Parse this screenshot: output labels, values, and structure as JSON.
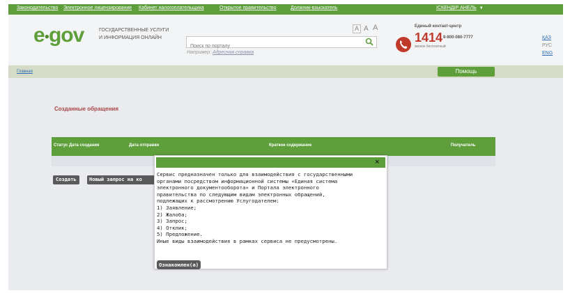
{
  "topnav": {
    "links": [
      "Законодательство",
      "Электронное лицензирование",
      "Кабинет налогоплательщика",
      "Открытое правительство",
      "Должник-взыскатель"
    ],
    "user": "ІСКЕНДІР АНЕЛЬ"
  },
  "header": {
    "logo": "e",
    "logo_tail": "gov",
    "tagline_line1": "ГОСУДАРСТВЕННЫЕ УСЛУГИ",
    "tagline_line2": "И ИНФОРМАЦИЯ ОНЛАЙН",
    "search_placeholder": "Поиск по порталу",
    "example_prefix": "Например:",
    "example_link": "Адресная справка",
    "font_sizes": [
      "A",
      "A",
      "A"
    ],
    "contact_label": "Единый контакт-центр",
    "contact_number": "1414",
    "contact_alt": "8-800-080-7777",
    "contact_free": "звонок бесплатный",
    "languages": [
      "ҚАЗ",
      "РУС",
      "ENG"
    ]
  },
  "breadcrumb": "Главная",
  "help_label": "Помощь",
  "page_title": "Созданные обращения",
  "table": {
    "columns": [
      "Статус",
      "Дата создания",
      "Дата отправки",
      "Краткое содержание",
      "Получатель"
    ]
  },
  "buttons": {
    "create": "Создать",
    "new_request": "Новый запрос на ко"
  },
  "modal": {
    "close": "×",
    "lines": [
      "Сервис предназначен только для взаимодействия с государственными",
      "органами посредством информационной системы «Единая система",
      "электронного документооборота» и Портала электронного",
      "правительства по следующим видам электронных обращений,",
      "подлежащих к рассмотрению Услугодателем:",
      "1) Заявление;",
      "2) Жалоба;",
      "3) Запрос;",
      "4) Отклик;",
      "5) Предложение.",
      "Иные виды взаимодействия в рамках сервиса не предусмотрены."
    ],
    "ack_label": "Ознакомлен(а)"
  },
  "colors": {
    "brand_green": "#5e9f3c",
    "title_red": "#a94444",
    "phone_red": "#c0392b",
    "button_gray": "#5a5a5a"
  },
  "icons": [
    "search-icon",
    "phone-icon",
    "close-icon",
    "chevron-down-icon"
  ]
}
